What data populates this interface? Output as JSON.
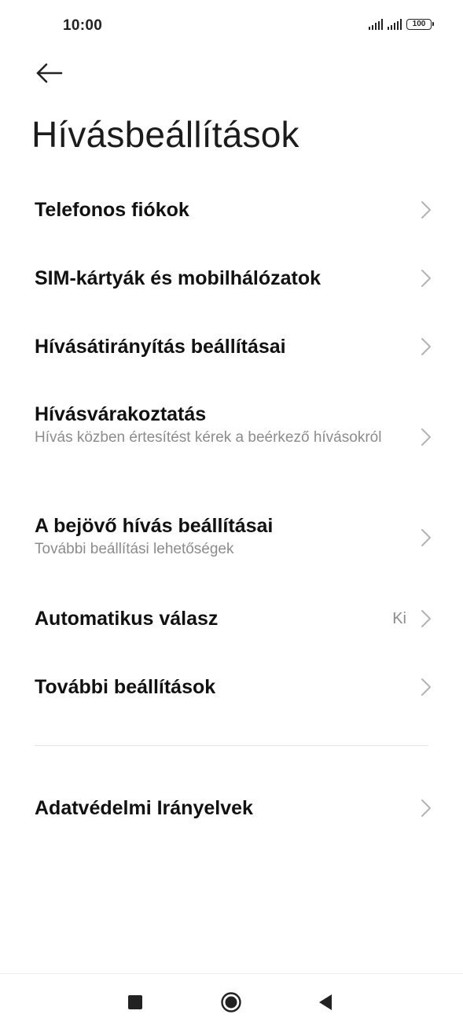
{
  "status_bar": {
    "time": "10:00",
    "battery_level": "100",
    "icons": [
      "signal-icon",
      "signal-icon",
      "battery-icon"
    ]
  },
  "header": {
    "back_icon": "arrow-left-icon",
    "title": "Hívásbeállítások"
  },
  "settings": {
    "items": [
      {
        "title": "Telefonos fiókok",
        "subtitle": "",
        "value": ""
      },
      {
        "title": "SIM-kártyák és mobilhálózatok",
        "subtitle": "",
        "value": ""
      },
      {
        "title": "Hívásátirányítás beállításai",
        "subtitle": "",
        "value": ""
      },
      {
        "title": "Hívásvárakoztatás",
        "subtitle": "Hívás közben értesítést kérek a beérkező hívásokról",
        "value": ""
      },
      {
        "title": "A bejövő hívás beállításai",
        "subtitle": "További beállítási lehetőségek",
        "value": ""
      },
      {
        "title": "Automatikus válasz",
        "subtitle": "",
        "value": "Ki"
      },
      {
        "title": "További beállítások",
        "subtitle": "",
        "value": ""
      }
    ],
    "privacy_item": {
      "title": "Adatvédelmi Irányelvek"
    }
  },
  "nav_bar": {
    "icons": [
      "recents-square-icon",
      "home-circle-icon",
      "back-triangle-icon"
    ]
  },
  "colors": {
    "background": "#ffffff",
    "text_primary": "#111111",
    "text_secondary": "#8c8c8c",
    "chevron": "#b3b3b3"
  }
}
